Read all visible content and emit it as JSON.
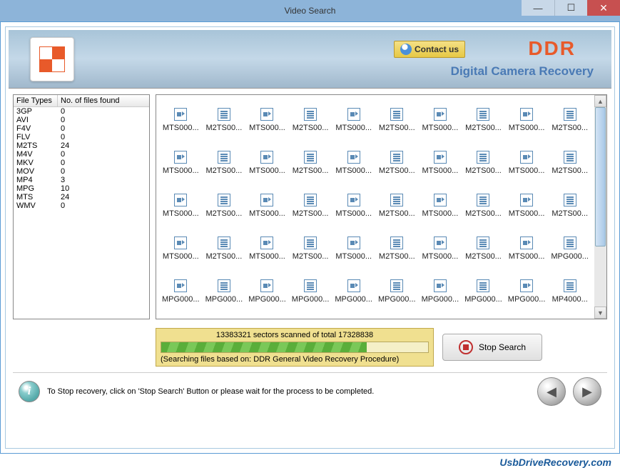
{
  "window": {
    "title": "Video Search"
  },
  "header": {
    "contact_label": "Contact us",
    "brand": "DDR",
    "subtitle": "Digital Camera Recovery"
  },
  "fileTypes": {
    "col1": "File Types",
    "col2": "No. of files found",
    "rows": [
      {
        "type": "3GP",
        "count": "0"
      },
      {
        "type": "AVI",
        "count": "0"
      },
      {
        "type": "F4V",
        "count": "0"
      },
      {
        "type": "FLV",
        "count": "0"
      },
      {
        "type": "M2TS",
        "count": "24"
      },
      {
        "type": "M4V",
        "count": "0"
      },
      {
        "type": "MKV",
        "count": "0"
      },
      {
        "type": "MOV",
        "count": "0"
      },
      {
        "type": "MP4",
        "count": "3"
      },
      {
        "type": "MPG",
        "count": "10"
      },
      {
        "type": "MTS",
        "count": "24"
      },
      {
        "type": "WMV",
        "count": "0"
      }
    ]
  },
  "files": {
    "row1": [
      "MTS000...",
      "M2TS00...",
      "MTS000...",
      "M2TS00...",
      "MTS000...",
      "M2TS00...",
      "MTS000...",
      "M2TS00...",
      "MTS000...",
      "M2TS00..."
    ],
    "row2": [
      "MTS000...",
      "M2TS00...",
      "MTS000...",
      "M2TS00...",
      "MTS000...",
      "M2TS00...",
      "MTS000...",
      "M2TS00...",
      "MTS000...",
      "M2TS00..."
    ],
    "row3": [
      "MTS000...",
      "M2TS00...",
      "MTS000...",
      "M2TS00...",
      "MTS000...",
      "M2TS00...",
      "MTS000...",
      "M2TS00...",
      "MTS000...",
      "M2TS00..."
    ],
    "row4": [
      "MTS000...",
      "M2TS00...",
      "MTS000...",
      "M2TS00...",
      "MTS000...",
      "M2TS00...",
      "MTS000...",
      "M2TS00...",
      "MTS000...",
      "MPG000..."
    ],
    "row5": [
      "MPG000...",
      "MPG000...",
      "MPG000...",
      "MPG000...",
      "MPG000...",
      "MPG000...",
      "MPG000...",
      "MPG000...",
      "MPG000...",
      "MP4000..."
    ]
  },
  "progress": {
    "sectors": "13383321 sectors scanned of total 17328838",
    "info": "(Searching files based on:  DDR General Video Recovery Procedure)",
    "stop_label": "Stop Search"
  },
  "footer": {
    "message": "To Stop recovery, click on 'Stop Search' Button or please wait for the process to be completed."
  },
  "url": "UsbDriveRecovery.com"
}
